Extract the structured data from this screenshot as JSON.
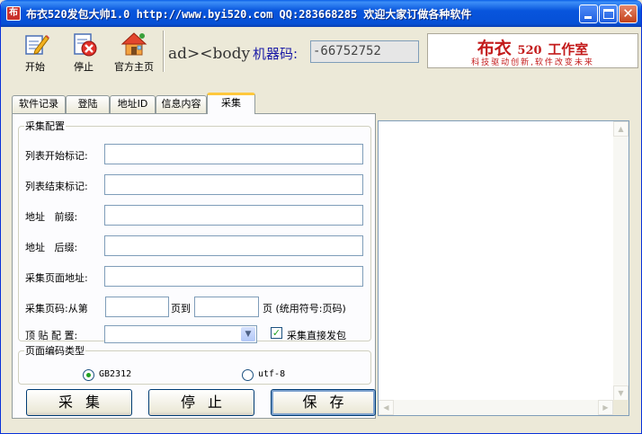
{
  "window": {
    "title": "布衣520发包大帅1.0  http://www.byi520.com QQ:283668285  欢迎大家订做各种软件",
    "app_icon_glyph": "布"
  },
  "toolbar": {
    "start_label": "开始",
    "stop_label": "停止",
    "home_label": "官方主页",
    "code_snippet": "ad><body",
    "machine_code_label": "机器码:",
    "machine_code_value": "-66752752"
  },
  "brand": {
    "name": "布衣",
    "number": "520",
    "suffix": "工作室",
    "slogan": "科技驱动创新,软件改变未来",
    "color": "#c31b1b"
  },
  "tabs": [
    {
      "label": "软件记录",
      "active": false
    },
    {
      "label": "登陆",
      "active": false
    },
    {
      "label": "地址ID",
      "active": false
    },
    {
      "label": "信息内容",
      "active": false
    },
    {
      "label": "采集",
      "active": true
    }
  ],
  "collect_config": {
    "legend": "采集配置",
    "list_start_label": "列表开始标记:",
    "list_start_value": "",
    "list_end_label": "列表结束标记:",
    "list_end_value": "",
    "address_prefix_label": "地址   前缀:",
    "address_prefix_value": "",
    "address_suffix_label": "地址   后缀:",
    "address_suffix_value": "",
    "page_address_label": "采集页面地址:",
    "page_address_value": "",
    "page_code_label": "采集页码:从第",
    "page_from_value": "",
    "page_to_label": "页到",
    "page_to_value": "",
    "page_hint_label": "页 (统用符号:页码)",
    "post_config_label": "顶 贴 配 置:",
    "post_config_value": "",
    "direct_post_label": "采集直接发包",
    "direct_post_checked": true
  },
  "encoding": {
    "legend": "页面编码类型",
    "options": [
      {
        "label": "GB2312",
        "selected": true
      },
      {
        "label": "utf-8",
        "selected": false
      }
    ]
  },
  "buttons": {
    "collect": "采集",
    "stop": "停止",
    "save": "保存"
  }
}
